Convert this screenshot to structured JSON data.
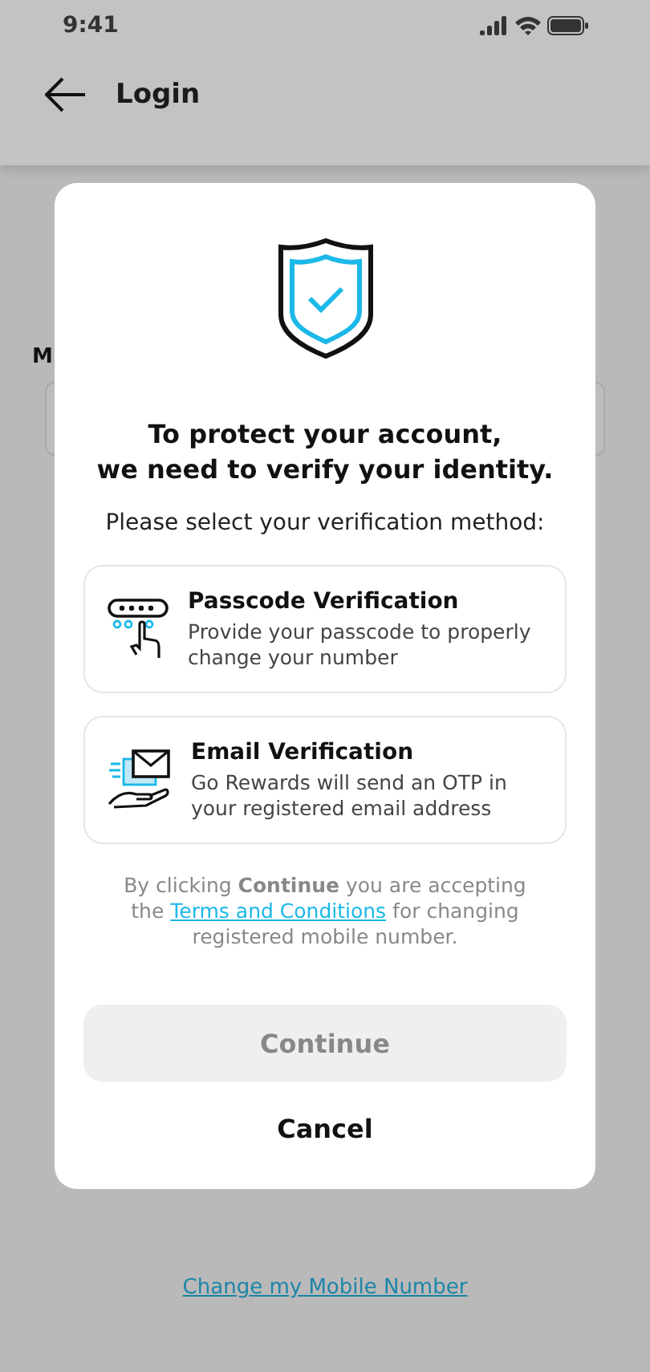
{
  "status_bar": {
    "time": "9:41"
  },
  "header": {
    "title": "Login"
  },
  "background": {
    "field_label": "M",
    "link": "Change my Mobile Number"
  },
  "dialog": {
    "title": "To protect your account,\nwe need to verify your identity.",
    "subtitle": "Please select your verification method:",
    "options": [
      {
        "kind": "passcode",
        "title": "Passcode Verification",
        "description": "Provide your passcode to properly change your number",
        "selected": false
      },
      {
        "kind": "email",
        "title": "Email Verification",
        "description": "Go Rewards will send an OTP in your registered email address",
        "selected": false
      }
    ],
    "consent": {
      "before": "By clicking **Continue** you are accepting the",
      "link": "Terms and Conditions",
      "after": "for changing registered mobile number."
    },
    "primary_button": {
      "label": "Continue",
      "disabled": true
    },
    "secondary_button": {
      "label": "Cancel"
    }
  }
}
